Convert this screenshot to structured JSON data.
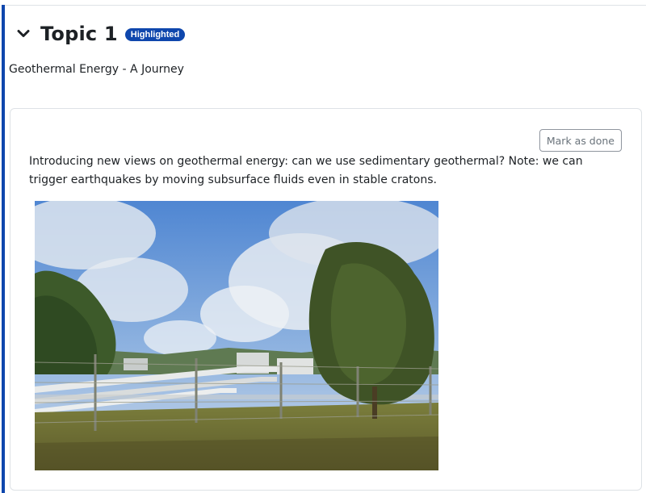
{
  "section": {
    "title": "Topic 1",
    "badge": "Highlighted",
    "summary": "Geothermal Energy - A Journey",
    "accent_color": "#0f47ad"
  },
  "activity": {
    "completion_button": "Mark as done",
    "description": "Introducing new views on geothermal energy: can we use sedimentary geothermal?  Note:  we can trigger earthquakes by moving subsurface fluids even in stable cratons.",
    "image_icon": "photo-geothermal-plant"
  }
}
